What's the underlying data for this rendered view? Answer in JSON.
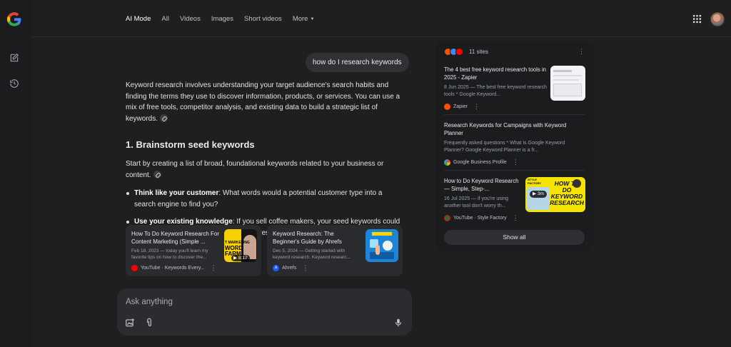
{
  "nav": {
    "tabs": [
      {
        "label": "AI Mode"
      },
      {
        "label": "All"
      },
      {
        "label": "Videos"
      },
      {
        "label": "Images"
      },
      {
        "label": "Short videos"
      },
      {
        "label": "More"
      }
    ]
  },
  "rail": {
    "icons": [
      "google-logo-icon",
      "new-chat-icon",
      "history-icon"
    ]
  },
  "query": "how do I research keywords",
  "answer": {
    "intro": "Keyword research involves understanding your target audience's search habits and finding the terms they use to discover information, products, or services. You can use a mix of free tools, competitor analysis, and existing data to build a strategic list of keywords.",
    "heading": "1. Brainstorm seed keywords",
    "step_text": "Start by creating a list of broad, foundational keywords related to your business or content.",
    "bullets": [
      {
        "bold": "Think like your customer",
        "text": ": What words would a potential customer type into a search engine to find you?"
      },
      {
        "bold": "Use your existing knowledge",
        "text": ": If you sell coffee makers, your seed keywords could include \"coffee,\" \"coffee maker,\" or \"espresso machine\"."
      }
    ]
  },
  "inline_sources": [
    {
      "title": "How To Do Keyword Research For Content Marketing (Simple ...",
      "snippet": "Feb 18, 2023 — today you'll learn my favorite tips on how to discover the...",
      "site": "YouTube · Keywords Every...",
      "thumb_text": "WORD FARM",
      "thumb_top_text": "T MARKETING",
      "duration": "8:17"
    },
    {
      "title": "Keyword Research: The Beginner's Guide by Ahrefs",
      "snippet": "Dec 5, 2024 — Getting started with keyword research. Keyword researc...",
      "site": "Ahrefs"
    }
  ],
  "ask": {
    "placeholder": "Ask anything"
  },
  "panel": {
    "sites_count": "11 sites",
    "items": [
      {
        "title": "The 4 best free keyword research tools in 2025 - Zapier",
        "snippet": "8 Jun 2025 — The best free keyword research tools * Google Keyword...",
        "site": "Zapier"
      },
      {
        "title": "Research Keywords for Campaigns with Keyword Planner",
        "snippet": "Frequently asked questions * What is Google Keyword Planner? Google Keyword Planner is a fr...",
        "site": "Google Business Profile"
      },
      {
        "title": "How to Do Keyword Research — Simple, Step-...",
        "snippet": "16 Jul 2025 — if you're using another tool don't worry th...",
        "site": "YouTube · Style Factory",
        "thumb_text": "HOW TO DO KEYWORD RESEARCH",
        "thumb_top_text": "STYLE FACTORY",
        "duration": "3m"
      }
    ],
    "show_all": "Show all"
  },
  "colors": {
    "background": "#1f1f1f",
    "panel": "#1b1c1e",
    "card": "#2a2b2e",
    "youtube_red": "#ff0000",
    "zapier_orange": "#ff4f00",
    "ahrefs_blue": "#1f5cff",
    "thumb_yellow": "#f5e400"
  }
}
